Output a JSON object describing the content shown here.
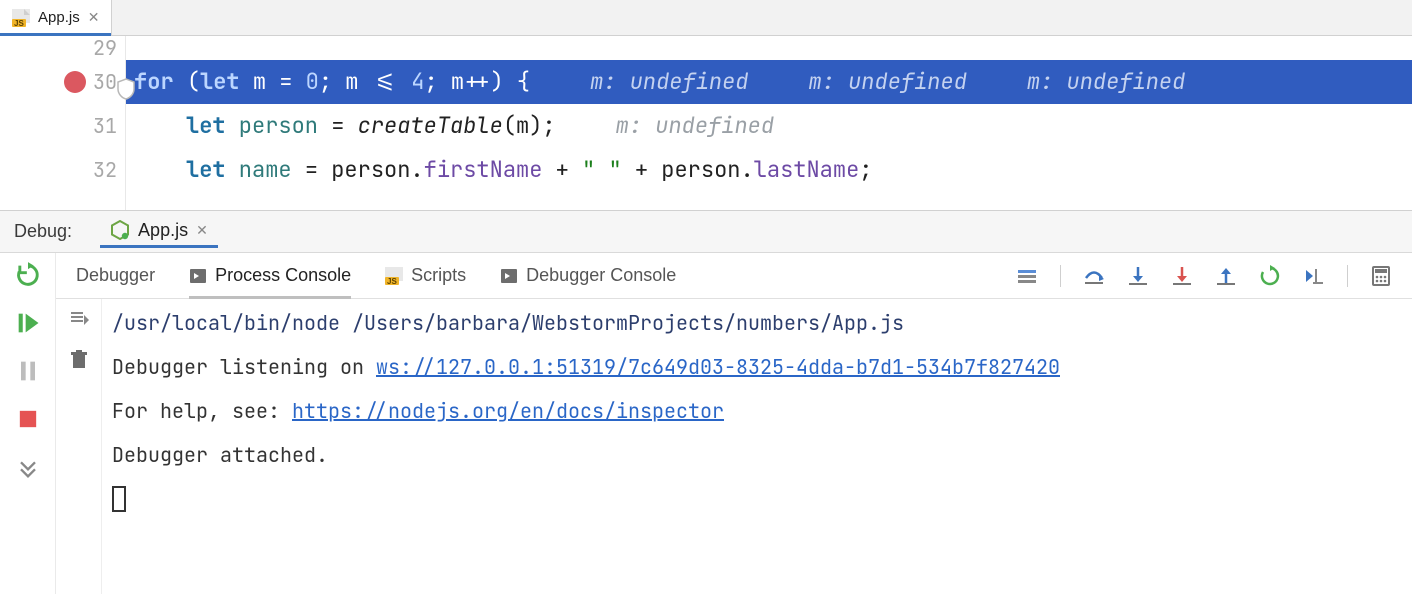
{
  "editor": {
    "tab": {
      "filename": "App.js"
    },
    "gutter": [
      "29",
      "30",
      "31",
      "32"
    ],
    "breakpoint_line_idx": 1,
    "current_exec_idx": 1,
    "code": {
      "line30": {
        "tokens": "for (let m = 0; m <= 4; m++) {",
        "hints": [
          "m: undefined",
          "m: undefined",
          "m: undefined"
        ]
      },
      "line31": {
        "hint": "m: undefined"
      }
    }
  },
  "debug": {
    "title": "Debug:",
    "run_config": "App.js",
    "tabs": {
      "debugger": "Debugger",
      "process_console": "Process Console",
      "scripts": "Scripts",
      "debugger_console": "Debugger Console"
    },
    "console": {
      "cmd": "/usr/local/bin/node /Users/barbara/WebstormProjects/numbers/App.js",
      "listening_prefix": "Debugger listening on ",
      "ws_url": "ws://127.0.0.1:51319/7c649d03-8325-4dda-b7d1-534b7f827420",
      "help_prefix": "For help, see: ",
      "help_url": "https://nodejs.org/en/docs/inspector",
      "attached": "Debugger attached."
    }
  },
  "code_tokens": {
    "l30_for": "for",
    "l30_open": " (",
    "l30_let": "let",
    "l30_m1": " m ",
    "l30_eq": "= ",
    "l30_0": "0",
    "l30_semi1": "; ",
    "l30_m2": "m ",
    "l30_le": "<= ",
    "l30_4": "4",
    "l30_semi2": "; ",
    "l30_m3": "m",
    "l30_pp": "++",
    "l30_cl": ") {",
    "l31_let": "let",
    "l31_person": " person ",
    "l31_eq": "= ",
    "l31_fn": "createTable",
    "l31_op": "(",
    "l31_arg": "m",
    "l31_cl": ");",
    "l32_let": "let",
    "l32_name": " name ",
    "l32_eq": "= ",
    "l32_p1": "person",
    "l32_dot1": ".",
    "l32_fn1": "firstName",
    "l32_plus1": " + ",
    "l32_str": "\" \"",
    "l32_plus2": " + ",
    "l32_p2": "person",
    "l32_dot2": ".",
    "l32_fn2": "lastName",
    "l32_semi": ";"
  }
}
